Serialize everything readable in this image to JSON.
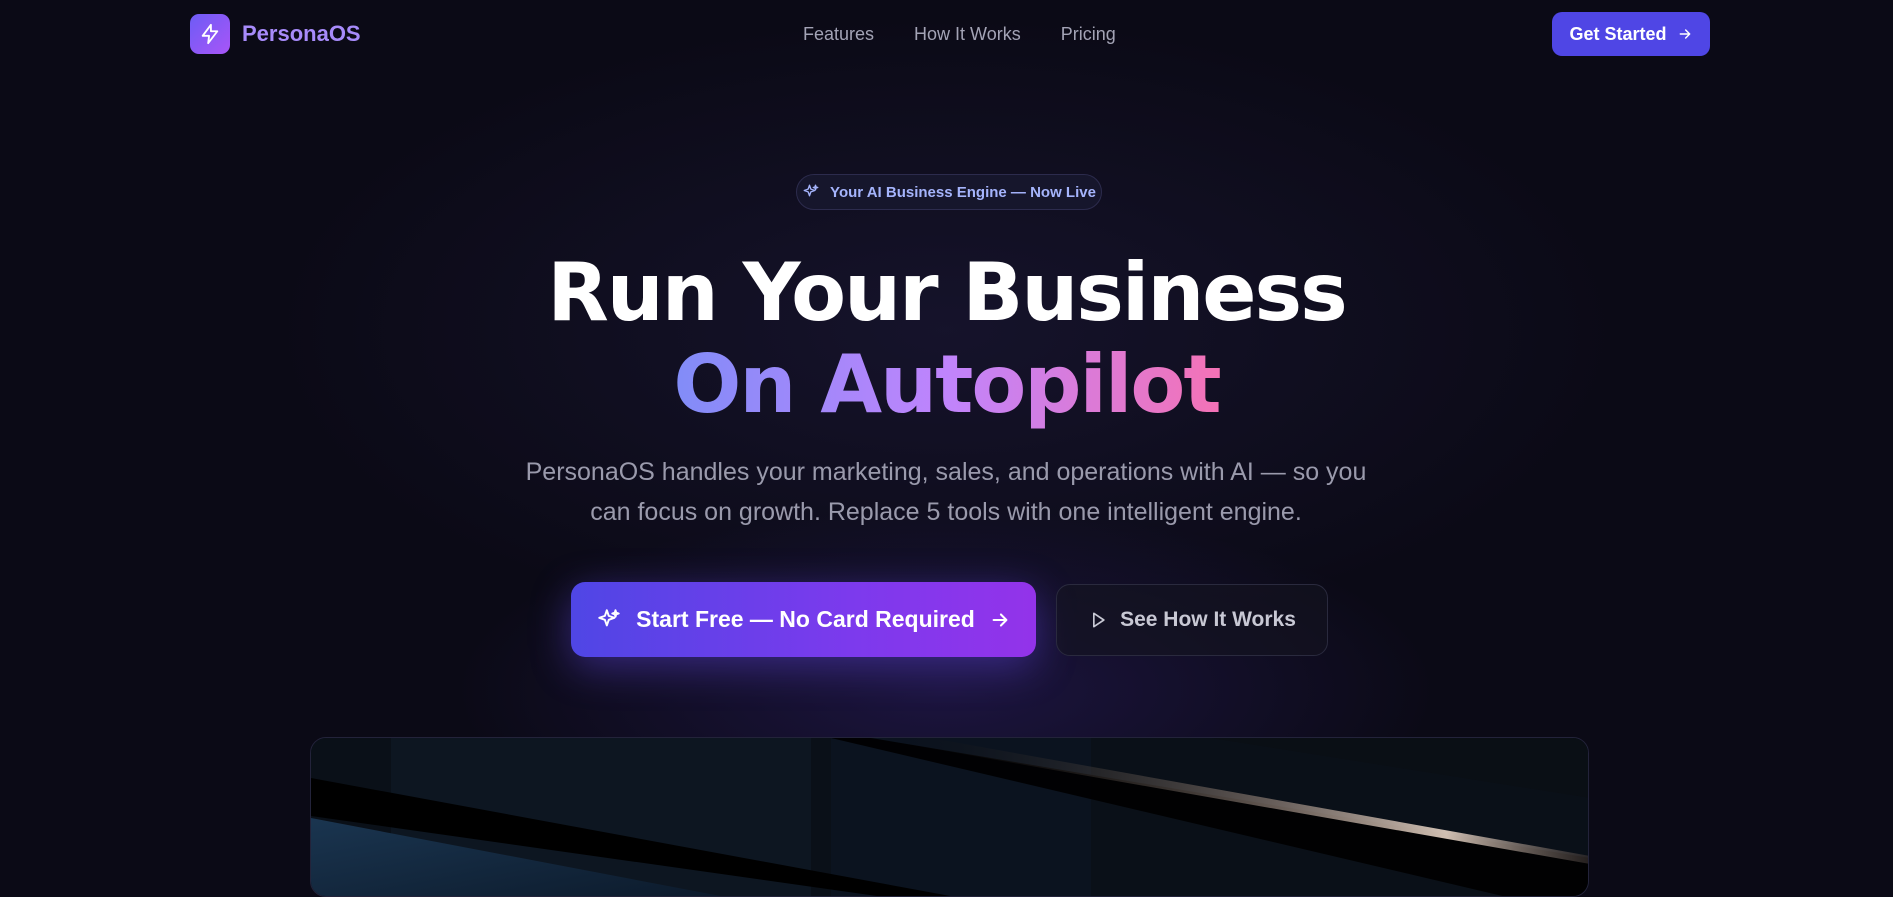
{
  "brand": {
    "name": "PersonaOS",
    "logo_icon": "bolt-icon",
    "accent": "#4f46e5",
    "accent_secondary": "#a855f7"
  },
  "nav": {
    "links": [
      "Features",
      "How It Works",
      "Pricing"
    ],
    "cta_label": "Get Started"
  },
  "hero": {
    "badge": "Your AI Business Engine — Now Live",
    "title_line1": "Run Your Business",
    "title_line2": "On Autopilot",
    "subtitle_line1": "PersonaOS handles your marketing, sales, and operations with AI — so you",
    "subtitle_line2": "can focus on growth. Replace 5 tools with one intelligent engine.",
    "primary_cta": "Start Free — No Card Required",
    "secondary_cta": "See How It Works",
    "gradient_colors": [
      "#818cf8",
      "#c084fc",
      "#f472b6"
    ]
  }
}
